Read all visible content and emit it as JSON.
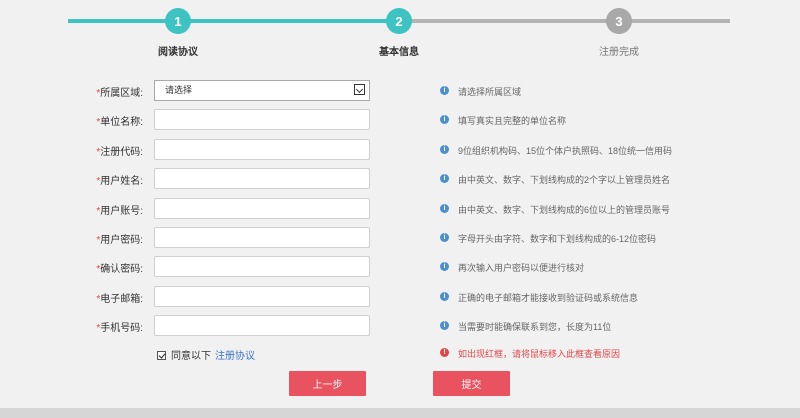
{
  "steps": [
    {
      "number": "1",
      "label": "阅读协议"
    },
    {
      "number": "2",
      "label": "基本信息"
    },
    {
      "number": "3",
      "label": "注册完成"
    }
  ],
  "form": {
    "region": {
      "label": "所属区域:",
      "value": "请选择",
      "hint": "请选择所属区域"
    },
    "unit_name": {
      "label": "单位名称:",
      "hint": "填写真实且完整的单位名称"
    },
    "reg_code": {
      "label": "注册代码:",
      "hint": "9位组织机构码、15位个体户执照码、18位统一信用码"
    },
    "user_name": {
      "label": "用户姓名:",
      "hint": "由中英文、数字、下划线构成的2个字以上管理员姓名"
    },
    "account": {
      "label": "用户账号:",
      "hint": "由中英文、数字、下划线构成的6位以上的管理员账号"
    },
    "password": {
      "label": "用户密码:",
      "hint": "字母开头由字符、数字和下划线构成的6-12位密码"
    },
    "confirm": {
      "label": "确认密码:",
      "hint": "再次输入用户密码以便进行核对"
    },
    "email": {
      "label": "电子邮箱:",
      "hint": "正确的电子邮箱才能接收到验证码或系统信息"
    },
    "phone": {
      "label": "手机号码:",
      "hint": "当需要时能确保联系到您，长度为11位"
    },
    "required_mark": "*"
  },
  "agreement": {
    "text": "同意以下",
    "link": "注册协议"
  },
  "error_hint": "如出现红框，请将鼠标移入此框查看原因",
  "buttons": {
    "prev": "上一步",
    "submit": "提交"
  },
  "colors": {
    "teal": "#3ec3c3",
    "gray": "#b3b3b3",
    "button": "#e9525f",
    "info": "#4a90d0",
    "error": "#e04848"
  }
}
